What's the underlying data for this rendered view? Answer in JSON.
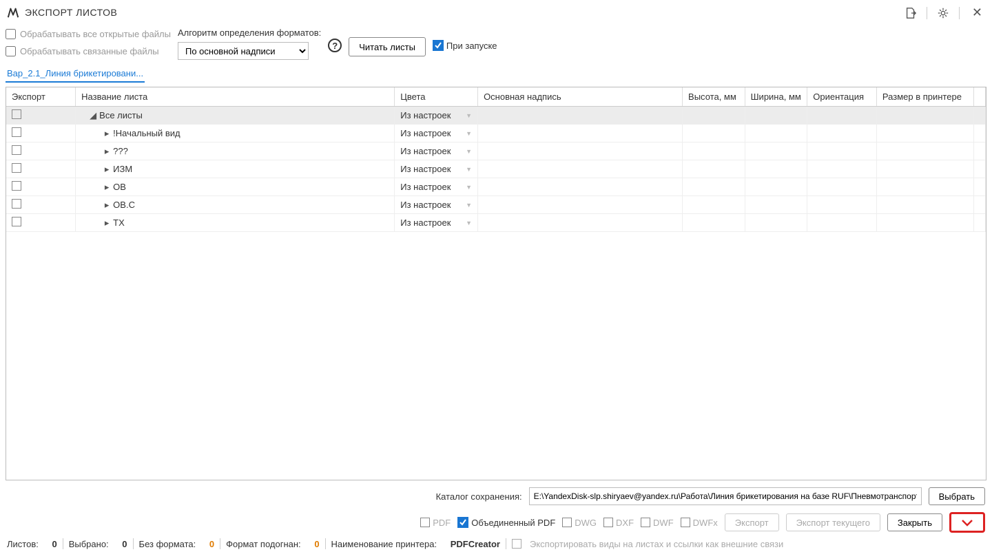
{
  "title": "ЭКСПОРТ ЛИСТОВ",
  "toolbar": {
    "process_open": "Обрабатывать все открытые файлы",
    "process_linked": "Обрабатывать связанные файлы",
    "alg_label": "Алгоритм определения форматов:",
    "alg_value": "По основной надписи",
    "read_sheets": "Читать листы",
    "on_start": "При запуске"
  },
  "tab": "Вар_2.1_Линия брикетировани...",
  "columns": {
    "export": "Экспорт",
    "name": "Название листа",
    "colors": "Цвета",
    "stamp": "Основная надпись",
    "height": "Высота, мм",
    "width": "Ширина, мм",
    "orient": "Ориентация",
    "psize": "Размер в принтере"
  },
  "all_sheets": "Все листы",
  "from_settings": "Из настроек",
  "rows": [
    {
      "name": "!Начальный вид"
    },
    {
      "name": "???"
    },
    {
      "name": "ИЗМ"
    },
    {
      "name": "ОВ"
    },
    {
      "name": "ОВ.С"
    },
    {
      "name": "ТХ"
    }
  ],
  "save": {
    "label": "Каталог сохранения:",
    "path": "E:\\YandexDisk-slp.shiryaev@yandex.ru\\Работа\\Линия брикетирования на базе RUF\\Пневмотранспорт",
    "choose": "Выбрать"
  },
  "formats": {
    "pdf": "PDF",
    "merged": "Объединенный PDF",
    "dwg": "DWG",
    "dxf": "DXF",
    "dwf": "DWF",
    "dwfx": "DWFx"
  },
  "buttons": {
    "export": "Экспорт",
    "export_current": "Экспорт текущего",
    "close": "Закрыть"
  },
  "status": {
    "sheets_l": "Листов:",
    "sheets_v": "0",
    "sel_l": "Выбрано:",
    "sel_v": "0",
    "nofmt_l": "Без формата:",
    "nofmt_v": "0",
    "fit_l": "Формат подогнан:",
    "fit_v": "0",
    "printer_l": "Наименование принтера:",
    "printer_v": "PDFCreator",
    "export_views": "Экспортировать виды на листах и ссылки как внешние связи"
  }
}
